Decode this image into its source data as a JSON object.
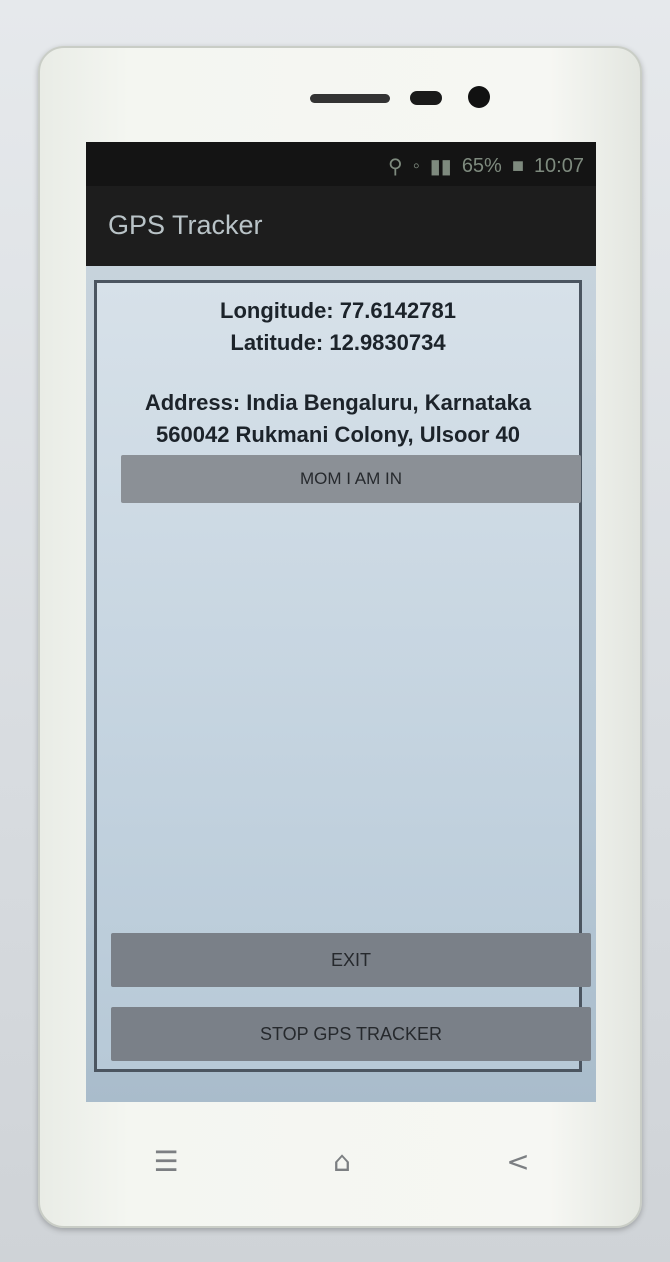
{
  "status_bar": {
    "battery_percent": "65%",
    "time": "10:07",
    "icons": [
      "location-icon",
      "wifi-icon",
      "signal-icon",
      "battery-icon"
    ]
  },
  "app": {
    "title": "GPS Tracker"
  },
  "location": {
    "longitude_line": "Longitude: 77.6142781",
    "latitude_line": "Latitude: 12.9830734",
    "address_line1": "Address:  India Bengaluru, Karnataka",
    "address_line2": "560042 Rukmani Colony, Ulsoor 40"
  },
  "buttons": {
    "mom_label": "MOM I AM IN",
    "exit_label": "EXIT",
    "stop_label": "STOP GPS TRACKER"
  },
  "navbar": {
    "menu_glyph": "☰",
    "home_glyph": "⌂",
    "back_glyph": "<"
  },
  "colors": {
    "action_bar": "#1d1d1d",
    "dialog_bg": "#c5d4e0",
    "button_bg": "#8b9096"
  }
}
